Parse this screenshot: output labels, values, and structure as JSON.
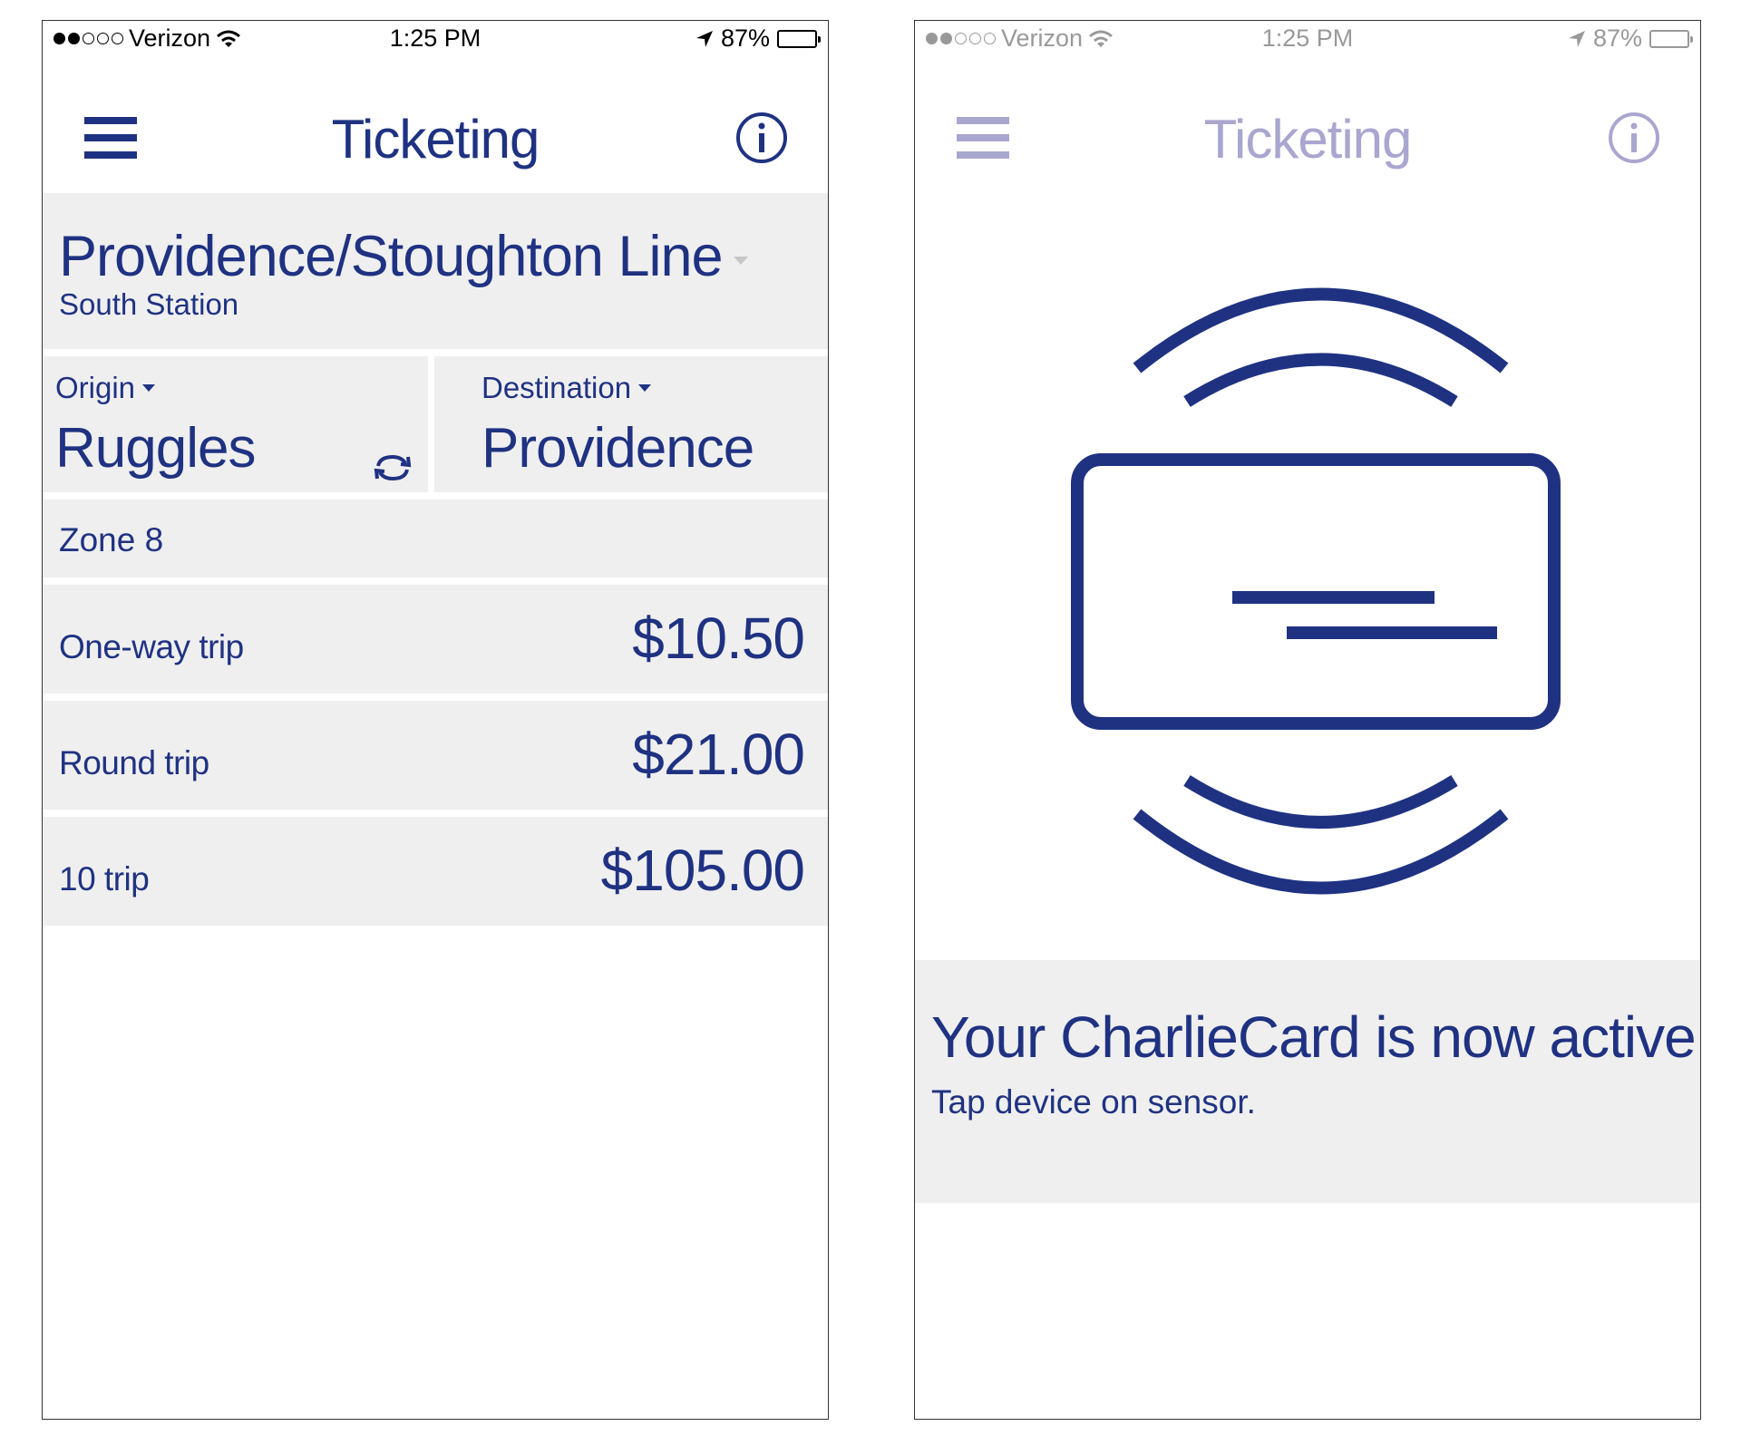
{
  "colors": {
    "brand_navy": "#1f3282",
    "panel_gray": "#efefef",
    "dimmed_nav": "#a9a6cf"
  },
  "left_screen": {
    "status_bar": {
      "carrier": "Verizon",
      "time": "1:25 PM",
      "battery": "87%",
      "signal_bars_filled": 2,
      "signal_bars_total": 5,
      "battery_level": 0.87
    },
    "nav": {
      "title": "Ticketing",
      "menu_icon": "hamburger-icon",
      "info_icon": "info-icon"
    },
    "line": {
      "name": "Providence/Stoughton Line",
      "station": "South Station"
    },
    "origin": {
      "label": "Origin",
      "value": "Ruggles"
    },
    "destination": {
      "label": "Destination",
      "value": "Providence"
    },
    "swap_icon": "swap-arrows-icon",
    "zone": "Zone 8",
    "fares": [
      {
        "label": "One-way trip",
        "price": "$10.50"
      },
      {
        "label": "Round trip",
        "price": "$21.00"
      },
      {
        "label": "10 trip",
        "price": "$105.00"
      }
    ]
  },
  "right_screen": {
    "status_bar": {
      "carrier": "Verizon",
      "time": "1:25 PM",
      "battery": "87%",
      "signal_bars_filled": 2,
      "signal_bars_total": 5,
      "battery_level": 0.87
    },
    "nav": {
      "title": "Ticketing",
      "menu_icon": "hamburger-icon",
      "info_icon": "info-icon"
    },
    "nfc_illustration": "contactless-card-icon",
    "message": {
      "title": "Your CharlieCard is now active.",
      "subtitle": "Tap device on sensor."
    }
  }
}
